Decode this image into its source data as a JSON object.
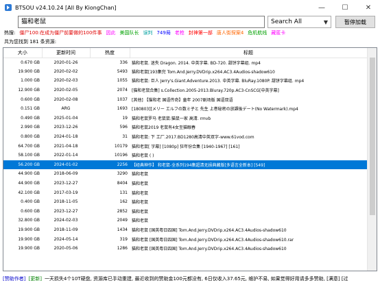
{
  "window": {
    "title": "BTSOU v24.10.24 [All By KiongChan]",
    "minimize": "—",
    "maximize": "☐",
    "close": "✕"
  },
  "toolbar": {
    "search_value": "猫和老鼠",
    "mode_selected": "Search All",
    "pause_label": "暂停加载"
  },
  "hot": {
    "label": "热搜:",
    "items": [
      {
        "text": "僵尸100:在成为僵尸前要做的100件事",
        "color": "#e00000"
      },
      {
        "text": "因此",
        "color": "#ff00ff"
      },
      {
        "text": "美国队长",
        "color": "#00a000"
      },
      {
        "text": "误判",
        "color": "#00a0a0"
      },
      {
        "text": "749局",
        "color": "#0000ff"
      },
      {
        "text": "老枪",
        "color": "#ff00ff"
      },
      {
        "text": "封神第一部",
        "color": "#ff0000"
      },
      {
        "text": "唐人街探案4",
        "color": "#ff6600"
      },
      {
        "text": "危机航线",
        "color": "#00a000"
      },
      {
        "text": "藏匿卡",
        "color": "#ff00ff"
      }
    ]
  },
  "count_text": "共为您找到 181 条资源:",
  "table": {
    "headers": [
      "大小",
      "更新时间",
      "热度",
      "标题"
    ],
    "rows": [
      {
        "size": "0.670 GB",
        "date": "2020-01-26",
        "heat": "336",
        "title": "猫和老鼠. 迷失 Dragon. 2014. 中英字幕. BD-720. 甜饼字幕组. mp4"
      },
      {
        "size": "19.900 GB",
        "date": "2020-02-02",
        "heat": "5493",
        "title": "猫和老鼠[193集完 Tom.And.Jerry.DVDrip.x264.AC3.4Audios-shadow610"
      },
      {
        "size": "1.000 GB",
        "date": "2020-02-03",
        "heat": "1055",
        "title": "猫和老鼠: 巨人 Jerry's.Giant.Adventure.2013. 中英字幕. BluRay.1080P. 甜饼字幕组. mp4"
      },
      {
        "size": "12.900 GB",
        "date": "2020-02-05",
        "heat": "2074",
        "title": "[猫和老鼠合集] s.Collection.2005-2013.Bluray.720p.AC3-CnSCG[中英字幕]"
      },
      {
        "size": "0.600 GB",
        "date": "2020-02-08",
        "heat": "1037",
        "title": "[其他] 【猫和老 国语传奇】童年 2007剧场版 国语双语"
      },
      {
        "size": "0.151 GB",
        "date": "ARG",
        "heat": "1693",
        "title": "[180803][メリー エルフの数ミ子と 先生 上巻秘密の放課後デート(No Watermark).mp4"
      },
      {
        "size": "0.490 GB",
        "date": "2025-01-04",
        "heat": "19",
        "title": "猫和老鼠罗马 老鼠鼠:猫鼠一家 高清. rmvb"
      },
      {
        "size": "2.990 GB",
        "date": "2023-12-26",
        "heat": "596",
        "title": "猫和老鼠2019 老鼠有4女至猫眼春"
      },
      {
        "size": "0.800 GB",
        "date": "2024-01-18",
        "heat": "31",
        "title": "猫和老鼠: 下 工厂.2017.BD1280高清中英双字-www.61vod.com"
      },
      {
        "size": "64.700 GB",
        "date": "2021-04-18",
        "heat": "10179",
        "title": "猫和老鼠[ 字幕] [1080p] 狂年份合集 [1940-1967] [161]"
      },
      {
        "size": "58.100 GB",
        "date": "2022-01-14",
        "heat": "10196",
        "title": "猫和老鼠 ( )"
      },
      {
        "size": "56.200 GB",
        "date": "2024-01-02",
        "heat": "2256",
        "title": "【经典神作】 和老鼠-全系列194集超清无损典藏版[多语言全新本] [549]"
      },
      {
        "size": "44.900 GB",
        "date": "2018-06-09",
        "heat": "3290",
        "title": "猫和老鼠"
      },
      {
        "size": "44.900 GB",
        "date": "2023-12-27",
        "heat": "8404",
        "title": "猫和老鼠"
      },
      {
        "size": "42.100 GB",
        "date": "2017-03-19",
        "heat": "131",
        "title": "猫和老鼠"
      },
      {
        "size": "0.400 GB",
        "date": "2018-11-05",
        "heat": "162",
        "title": "猫和老鼠"
      },
      {
        "size": "0.600 GB",
        "date": "2023-12-27",
        "heat": "2852",
        "title": "猫和老鼠"
      },
      {
        "size": "32.800 GB",
        "date": "2024-02-03",
        "heat": "2049",
        "title": "猫和老鼠"
      },
      {
        "size": "19.900 GB",
        "date": "2018-11-09",
        "heat": "1434",
        "title": "猫和老鼠 [国英粤日四国] Tom.And.Jerry.DVDrip.x264.AC3.4Audios-shadow610"
      },
      {
        "size": "19.900 GB",
        "date": "2024-05-14",
        "heat": "319",
        "title": "猫和老鼠 [国英粤日四国] Tom.And.Jerry.DVDrip.x264.AC3.4Audios-shadow610.rar"
      },
      {
        "size": "19.900 GB",
        "date": "2020-05-06",
        "heat": "1286",
        "title": "猫和老鼠 [国英粤日四国] Tom.And.Jerry.DVDrip.x264.AC3.4Audios-shadow610"
      }
    ]
  },
  "status": {
    "sponsor": "[赞助作者]",
    "update": "[更新]",
    "message": "一天损失4个10T硬盘, 资源库已手动重建, 最近收到的赞助金100元都没有, 6日仅收入37.65元, 维护不易, 如果觉得好用请多多赞助, [满意] [过"
  }
}
